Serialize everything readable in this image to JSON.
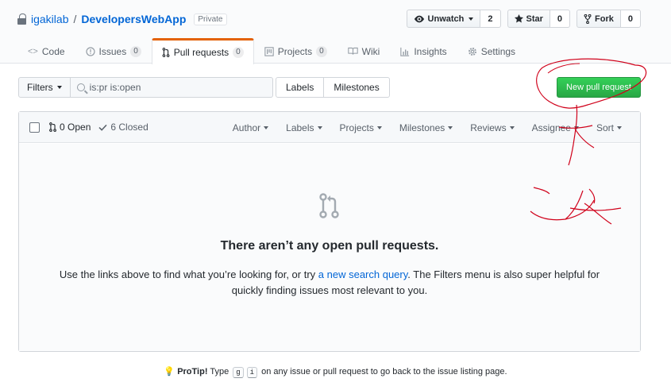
{
  "repo": {
    "owner": "igakilab",
    "separator": "/",
    "name": "DevelopersWebApp",
    "visibility": "Private"
  },
  "actions": {
    "watch_label": "Unwatch",
    "watch_count": "2",
    "star_label": "Star",
    "star_count": "0",
    "fork_label": "Fork",
    "fork_count": "0"
  },
  "tabs": [
    {
      "label": "Code",
      "icon": "code-icon"
    },
    {
      "label": "Issues",
      "count": "0",
      "icon": "issue-icon"
    },
    {
      "label": "Pull requests",
      "count": "0",
      "icon": "pull-request-icon",
      "selected": true
    },
    {
      "label": "Projects",
      "count": "0",
      "icon": "project-icon"
    },
    {
      "label": "Wiki",
      "icon": "book-icon"
    },
    {
      "label": "Insights",
      "icon": "graph-icon"
    },
    {
      "label": "Settings",
      "icon": "gear-icon"
    }
  ],
  "filter": {
    "filters_label": "Filters",
    "search_value": "is:pr is:open"
  },
  "nav": {
    "labels": "Labels",
    "milestones": "Milestones"
  },
  "new_pr_label": "New pull request",
  "list": {
    "open_label": "0 Open",
    "closed_label": "6 Closed",
    "sorts": [
      "Author",
      "Labels",
      "Projects",
      "Milestones",
      "Reviews",
      "Assignee",
      "Sort"
    ]
  },
  "blankslate": {
    "title": "There aren’t any open pull requests.",
    "text_before": "Use the links above to find what you’re looking for, or try ",
    "link_text": "a new search query",
    "text_after": ". The Filters menu is also super helpful for quickly finding issues most relevant to you."
  },
  "protip": {
    "prefix": "ProTip!",
    "type_word": "Type",
    "key1": "g",
    "key2": "i",
    "suffix": "on any issue or pull request to go back to the issue listing page."
  },
  "colors": {
    "accent_orange": "#e36209",
    "link_blue": "#0366d6",
    "primary_green": "#28a745",
    "annotation_red": "#d0021b"
  }
}
